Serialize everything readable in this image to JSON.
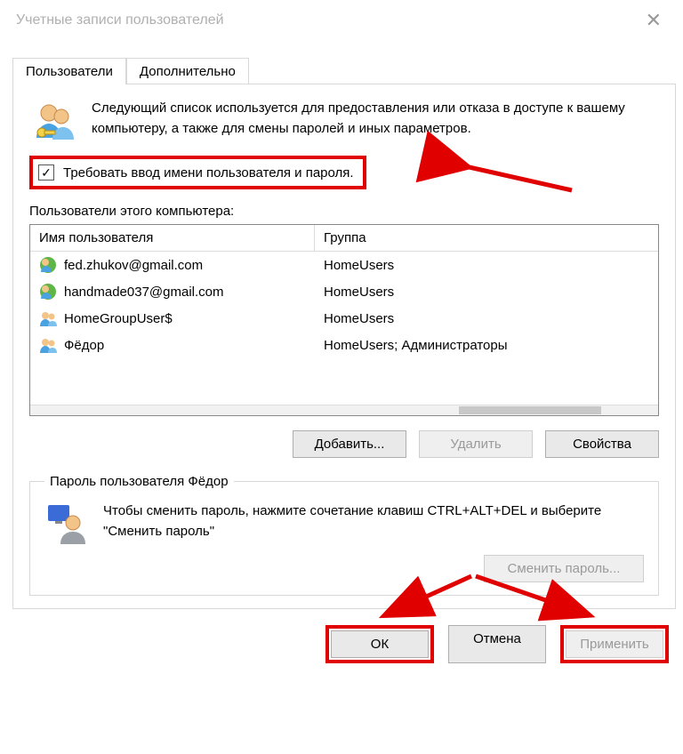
{
  "window": {
    "title": "Учетные записи пользователей"
  },
  "tabs": [
    {
      "label": "Пользователи",
      "active": true
    },
    {
      "label": "Дополнительно",
      "active": false
    }
  ],
  "intro_text": "Следующий список используется для предоставления или отказа в доступе к вашему компьютеру, а также для смены паролей и иных параметров.",
  "require_checkbox": {
    "checked": true,
    "label": "Требовать ввод имени пользователя и пароля."
  },
  "users_list_label": "Пользователи этого компьютера:",
  "table": {
    "headers": {
      "name": "Имя пользователя",
      "group": "Группа"
    },
    "rows": [
      {
        "icon": "user-globe",
        "name": "fed.zhukov@gmail.com",
        "group": "HomeUsers"
      },
      {
        "icon": "user-globe",
        "name": "handmade037@gmail.com",
        "group": "HomeUsers"
      },
      {
        "icon": "user-pair",
        "name": "HomeGroupUser$",
        "group": "HomeUsers"
      },
      {
        "icon": "user-pair",
        "name": "Фёдор",
        "group": "HomeUsers; Администраторы"
      }
    ]
  },
  "buttons": {
    "add": "Добавить...",
    "remove": "Удалить",
    "properties": "Свойства"
  },
  "password_group": {
    "legend": "Пароль пользователя Фёдор",
    "text": "Чтобы сменить пароль, нажмите сочетание клавиш CTRL+ALT+DEL и выберите \"Сменить пароль\"",
    "button": "Сменить пароль..."
  },
  "dialog": {
    "ok": "ОК",
    "cancel": "Отмена",
    "apply": "Применить"
  }
}
